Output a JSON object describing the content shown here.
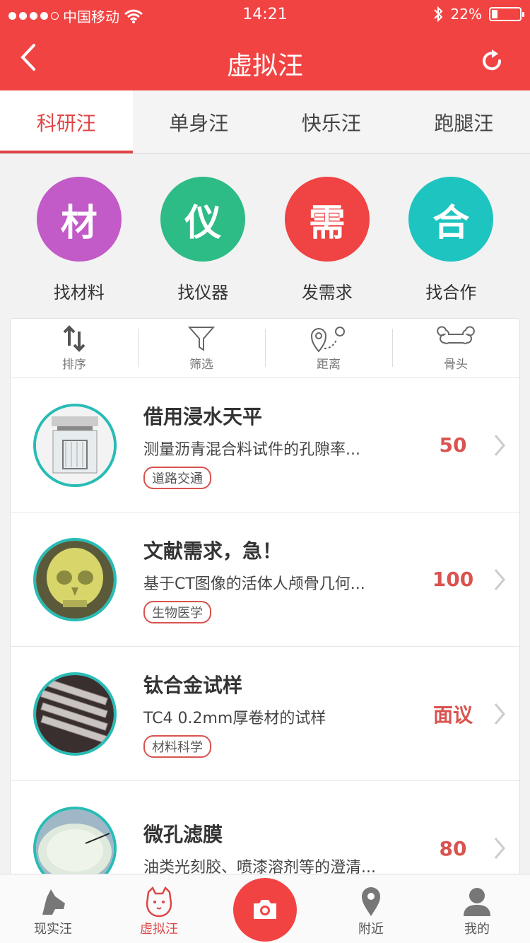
{
  "status_bar": {
    "carrier": "中国移动",
    "time": "14:21",
    "battery": "22%",
    "battery_level": 0.22
  },
  "nav": {
    "title": "虚拟汪"
  },
  "tabs": [
    {
      "label": "科研汪",
      "active": true
    },
    {
      "label": "单身汪",
      "active": false
    },
    {
      "label": "快乐汪",
      "active": false
    },
    {
      "label": "跑腿汪",
      "active": false
    }
  ],
  "quick_actions": [
    {
      "glyph": "材",
      "label": "找材料",
      "color": "#c25ac8"
    },
    {
      "glyph": "仪",
      "label": "找仪器",
      "color": "#2dbb86"
    },
    {
      "glyph": "需",
      "label": "发需求",
      "color": "#f04343"
    },
    {
      "glyph": "合",
      "label": "找合作",
      "color": "#1ec4c0"
    }
  ],
  "filters": [
    {
      "label": "排序",
      "icon": "sort-icon"
    },
    {
      "label": "筛选",
      "icon": "funnel-icon"
    },
    {
      "label": "距离",
      "icon": "location-route-icon"
    },
    {
      "label": "骨头",
      "icon": "bone-icon"
    }
  ],
  "items": [
    {
      "title": "借用浸水天平",
      "desc": "测量沥青混合料试件的孔隙率...",
      "tag": "道路交通",
      "price": "50"
    },
    {
      "title": "文献需求，急！",
      "desc": "基于CT图像的活体人颅骨几何...",
      "tag": "生物医学",
      "price": "100"
    },
    {
      "title": "钛合金试样",
      "desc": "TC4 0.2mm厚卷材的试样",
      "tag": "材料科学",
      "price": "面议"
    },
    {
      "title": "微孔滤膜",
      "desc": "油类光刻胶、喷漆溶剂等的澄清...",
      "tag": "",
      "price": "80"
    }
  ],
  "tabbar": {
    "items": [
      {
        "label": "现实汪",
        "icon": "dog-head-icon"
      },
      {
        "label": "虚拟汪",
        "icon": "shiba-icon",
        "active": true
      },
      {
        "label": "",
        "icon": "camera-icon"
      },
      {
        "label": "附近",
        "icon": "location-pin-icon"
      },
      {
        "label": "我的",
        "icon": "user-icon"
      }
    ]
  },
  "colors": {
    "brand": "#f24343",
    "accent": "#e04545",
    "thumb_border": "#27bcb5"
  }
}
